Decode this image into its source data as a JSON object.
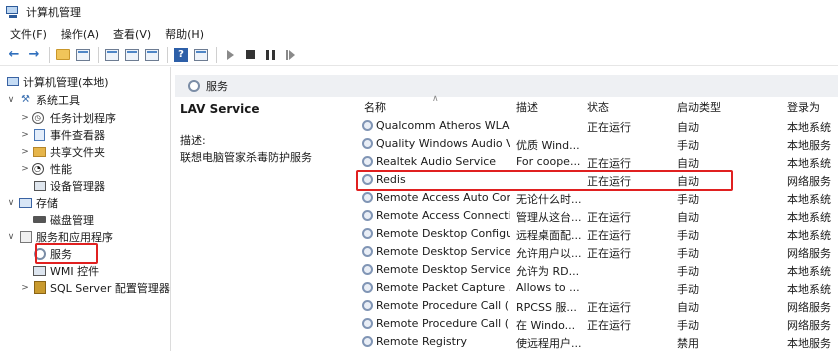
{
  "window": {
    "title": "计算机管理"
  },
  "menu": [
    "文件(F)",
    "操作(A)",
    "查看(V)",
    "帮助(H)"
  ],
  "tree": {
    "root": "计算机管理(本地)",
    "system_tools": "系统工具",
    "task_scheduler": "任务计划程序",
    "event_viewer": "事件查看器",
    "shared_folders": "共享文件夹",
    "performance": "性能",
    "device_manager": "设备管理器",
    "storage": "存储",
    "disk_management": "磁盘管理",
    "services_apps": "服务和应用程序",
    "services": "服务",
    "wmi": "WMI 控件",
    "sql_server": "SQL Server 配置管理器"
  },
  "panel": {
    "title": "服务"
  },
  "details": {
    "service_name": "LAV Service",
    "desc_label": "描述:",
    "desc_text": "联想电脑管家杀毒防护服务"
  },
  "columns": {
    "name": "名称",
    "description": "描述",
    "status": "状态",
    "startup": "启动类型",
    "logon": "登录为"
  },
  "services": [
    {
      "name": "Qualcomm Atheros WLA...",
      "description": "",
      "status": "正在运行",
      "startup": "自动",
      "logon": "本地系统"
    },
    {
      "name": "Quality Windows Audio V...",
      "description": "优质 Wind...",
      "status": "",
      "startup": "手动",
      "logon": "本地服务"
    },
    {
      "name": "Realtek Audio Service",
      "description": "For coope...",
      "status": "正在运行",
      "startup": "自动",
      "logon": "本地系统"
    },
    {
      "name": "Redis",
      "description": "",
      "status": "正在运行",
      "startup": "自动",
      "logon": "网络服务"
    },
    {
      "name": "Remote Access Auto Con...",
      "description": "无论什么时...",
      "status": "",
      "startup": "手动",
      "logon": "本地系统"
    },
    {
      "name": "Remote Access Connecti...",
      "description": "管理从这台...",
      "status": "正在运行",
      "startup": "自动",
      "logon": "本地系统"
    },
    {
      "name": "Remote Desktop Configu...",
      "description": "远程桌面配...",
      "status": "正在运行",
      "startup": "手动",
      "logon": "本地系统"
    },
    {
      "name": "Remote Desktop Services",
      "description": "允许用户以...",
      "status": "正在运行",
      "startup": "手动",
      "logon": "网络服务"
    },
    {
      "name": "Remote Desktop Service...",
      "description": "允许为 RD...",
      "status": "",
      "startup": "手动",
      "logon": "本地系统"
    },
    {
      "name": "Remote Packet Capture ...",
      "description": "Allows to ...",
      "status": "",
      "startup": "手动",
      "logon": "本地系统"
    },
    {
      "name": "Remote Procedure Call (...",
      "description": "RPCSS 服...",
      "status": "正在运行",
      "startup": "自动",
      "logon": "网络服务"
    },
    {
      "name": "Remote Procedure Call (...",
      "description": "在 Windo...",
      "status": "正在运行",
      "startup": "手动",
      "logon": "网络服务"
    },
    {
      "name": "Remote Registry",
      "description": "使远程用户...",
      "status": "",
      "startup": "禁用",
      "logon": "本地服务"
    }
  ],
  "colors": {
    "highlight_box": "#e02020",
    "header_bg": "#eef0f3"
  }
}
